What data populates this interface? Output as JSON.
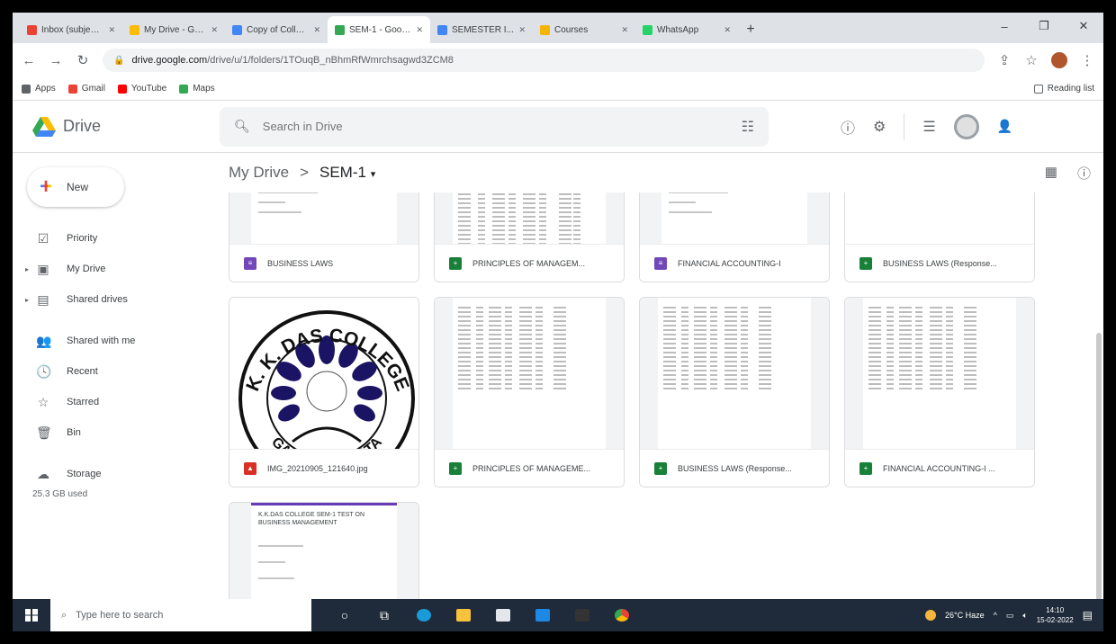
{
  "browser": {
    "tabs": [
      {
        "label": "Inbox (subject) - In...",
        "color": "#ea4335",
        "active": false
      },
      {
        "label": "My Drive - Goo...",
        "color": "#fbbc04",
        "active": false
      },
      {
        "label": "Copy of College...",
        "color": "#4285f4",
        "active": false
      },
      {
        "label": "SEM-1 - Google...",
        "color": "#34a853",
        "active": true
      },
      {
        "label": "SEMESTER I...",
        "color": "#4285f4",
        "active": false
      },
      {
        "label": "Courses",
        "color": "#f4b400",
        "active": false
      },
      {
        "label": "WhatsApp",
        "color": "#25d366",
        "active": false
      }
    ],
    "new_tab": "+",
    "window_controls": {
      "minimize": "–",
      "maximize": "❐",
      "close": "✕"
    },
    "url": "drive.google.com",
    "url_path": "/drive/u/1/folders/1TOuqB_nBhmRfWmrchsagwd3ZCM8",
    "bookmarks": [
      {
        "label": "Apps",
        "color": "#5f6368"
      },
      {
        "label": "Gmail",
        "color": "#ea4335"
      },
      {
        "label": "YouTube",
        "color": "#ff0000"
      },
      {
        "label": "Maps",
        "color": "#34a853"
      }
    ],
    "reading_list": "Reading list"
  },
  "drive": {
    "app_name": "Drive",
    "search_placeholder": "Search in Drive",
    "new_label": "New",
    "nav": [
      {
        "label": "Priority",
        "icon": "priority-icon",
        "glyph": "☑",
        "arrow": false
      },
      {
        "label": "My Drive",
        "icon": "my-drive-icon",
        "glyph": "▣",
        "arrow": true
      },
      {
        "label": "Shared drives",
        "icon": "shared-drives-icon",
        "glyph": "▤",
        "arrow": true
      },
      {
        "label": "Shared with me",
        "icon": "shared-with-me-icon",
        "glyph": "👥",
        "arrow": false,
        "gap_before": true
      },
      {
        "label": "Recent",
        "icon": "recent-icon",
        "glyph": "🕓",
        "arrow": false
      },
      {
        "label": "Starred",
        "icon": "starred-icon",
        "glyph": "☆",
        "arrow": false
      },
      {
        "label": "Bin",
        "icon": "bin-icon",
        "glyph": "🗑",
        "arrow": false
      },
      {
        "label": "Storage",
        "icon": "storage-icon",
        "glyph": "☁",
        "arrow": false,
        "gap_before": true
      }
    ],
    "storage_text": "25.3 GB used",
    "breadcrumb": {
      "root": "My Drive",
      "separator": ">",
      "current": "SEM-1"
    },
    "files": [
      {
        "name": "BUSINESS LAWS",
        "type": "form",
        "color": "#7248b9"
      },
      {
        "name": "PRINCIPLES OF MANAGEM...",
        "type": "sheet",
        "color": "#188038"
      },
      {
        "name": "FINANCIAL ACCOUNTING-I",
        "type": "form",
        "color": "#7248b9"
      },
      {
        "name": "BUSINESS LAWS (Response...",
        "type": "sheet",
        "color": "#188038"
      },
      {
        "name": "IMG_20210905_121640.jpg",
        "type": "image",
        "color": "#d93025"
      },
      {
        "name": "PRINCIPLES OF MANAGEME...",
        "type": "sheet",
        "color": "#188038"
      },
      {
        "name": "BUSINESS LAWS (Response...",
        "type": "sheet",
        "color": "#188038"
      },
      {
        "name": "FINANCIAL ACCOUNTING-I ...",
        "type": "sheet",
        "color": "#188038"
      }
    ],
    "college_logo_text": {
      "top": "K. K. DAS COLLEGE",
      "bottom": "GARIA · KOLKATA"
    },
    "partial_doc_text": "K.K.DAS COLLEGE SEM-1 TEST ON BUSINESS MANAGEMENT"
  },
  "taskbar": {
    "search_placeholder": "Type here to search",
    "weather": "26°C Haze",
    "time": "14:10",
    "date": "15-02-2022"
  }
}
